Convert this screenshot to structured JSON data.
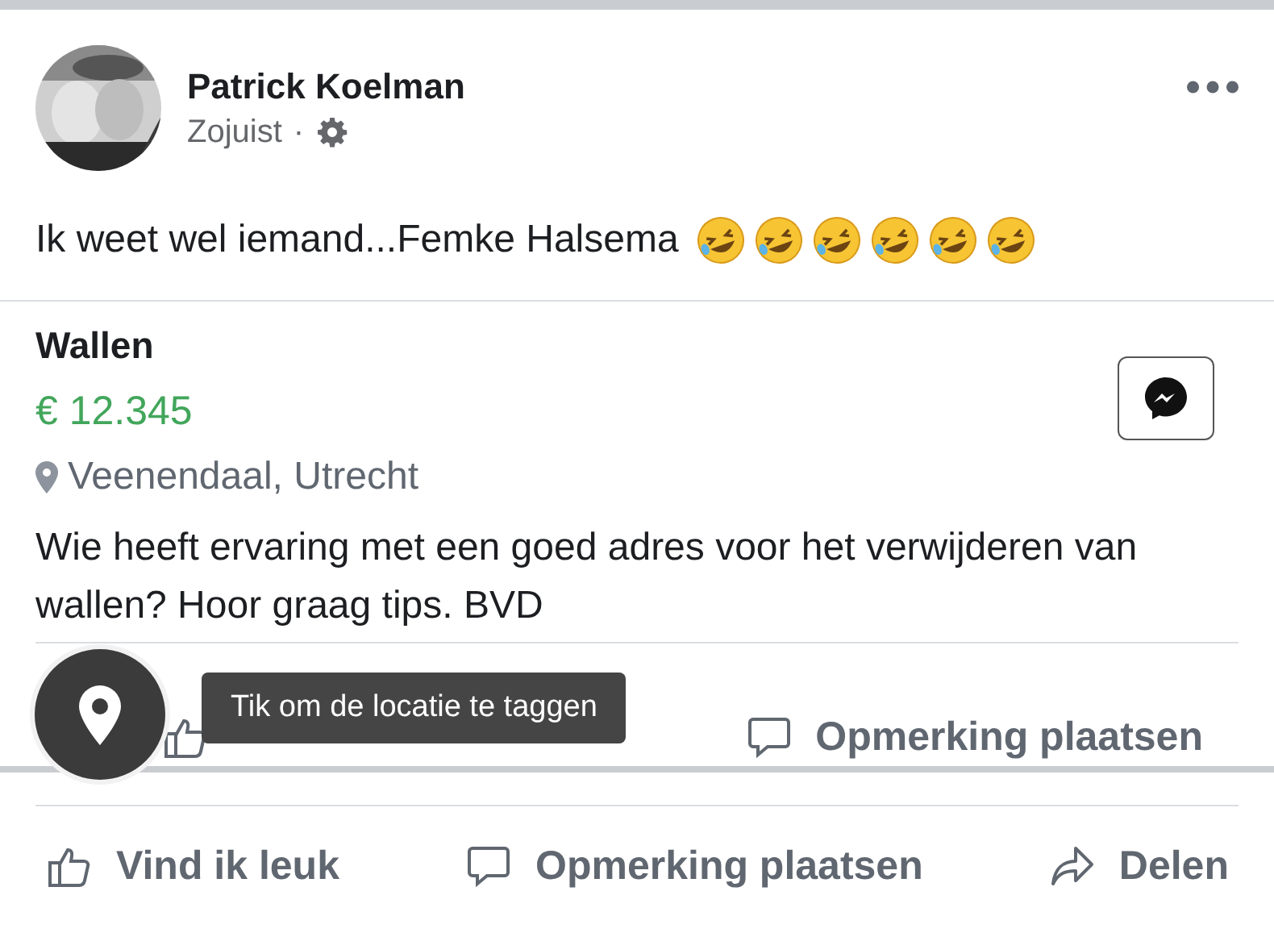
{
  "post": {
    "author": "Patrick Koelman",
    "time": "Zojuist",
    "separator": "·",
    "text": "Ik weet wel iemand...Femke Halsema",
    "emojis": [
      {
        "kind": "rofl"
      },
      {
        "kind": "rofl"
      },
      {
        "kind": "rofl"
      },
      {
        "kind": "rofl"
      },
      {
        "kind": "rofl"
      },
      {
        "kind": "rofl"
      }
    ]
  },
  "listing": {
    "title": "Wallen",
    "price": "€ 12.345",
    "location": "Veenendaal, Utrecht",
    "description": "Wie heeft ervaring met een goed adres voor het verwijderen van wallen? Hoor graag tips. BVD"
  },
  "inner_actions": [
    {
      "kind": "like"
    },
    {
      "kind": "comment",
      "label": "Opmerking plaatsen"
    }
  ],
  "tooltip": {
    "text": "Tik om de locatie te taggen"
  },
  "actions": [
    {
      "kind": "like",
      "label": "Vind ik leuk"
    },
    {
      "kind": "comment",
      "label": "Opmerking plaatsen"
    },
    {
      "kind": "share",
      "label": "Delen"
    }
  ]
}
